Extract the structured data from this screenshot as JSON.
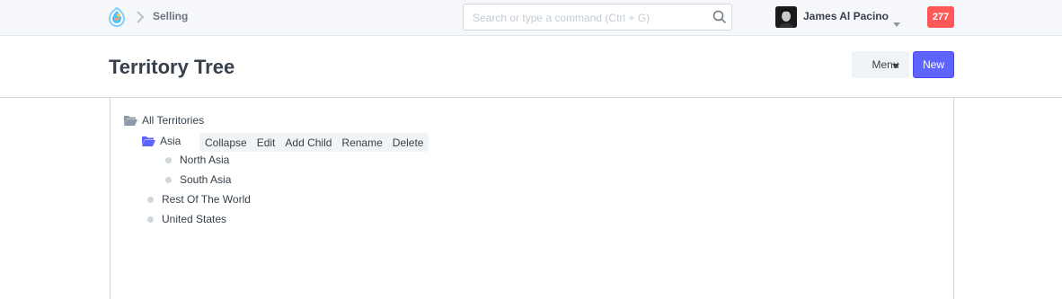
{
  "navbar": {
    "breadcrumb": "Selling",
    "search_placeholder": "Search or type a command (Ctrl + G)",
    "user_name": "James Al Pacino",
    "notification_count": "277"
  },
  "page": {
    "title": "Territory Tree",
    "menu_label": "Menu",
    "new_label": "New"
  },
  "tree": {
    "root": "All Territories",
    "asia": "Asia",
    "north_asia": "North Asia",
    "south_asia": "South Asia",
    "rest_of_world": "Rest Of The World",
    "united_states": "United States"
  },
  "node_toolbar": {
    "collapse": "Collapse",
    "edit": "Edit",
    "add_child": "Add Child",
    "rename": "Rename",
    "delete": "Delete"
  },
  "colors": {
    "accent": "#5e64ff",
    "notification": "#ff5858",
    "folder_open_selected": "#5e64ff",
    "folder_root": "#8d99a6"
  }
}
